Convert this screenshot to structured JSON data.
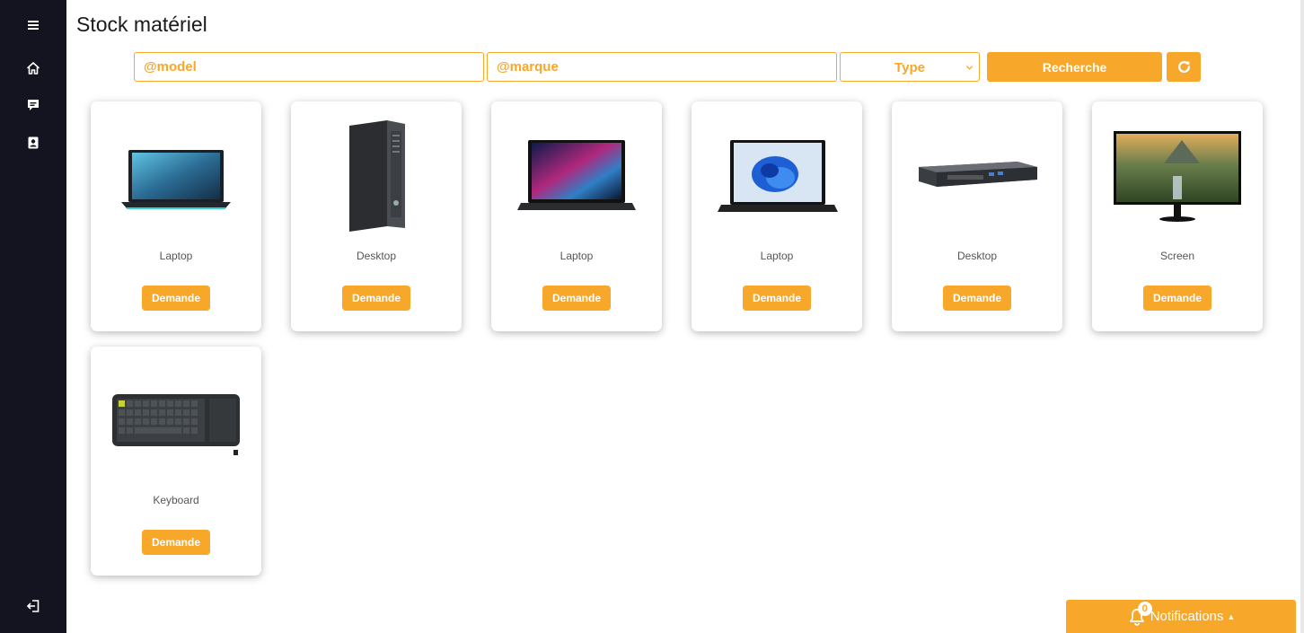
{
  "sidebar": {
    "items": [
      {
        "icon": "menu-icon"
      },
      {
        "icon": "home-icon"
      },
      {
        "icon": "chat-icon"
      },
      {
        "icon": "contact-card-icon"
      }
    ],
    "logout_icon": "logout-icon"
  },
  "header": {
    "title": "Stock matériel"
  },
  "search": {
    "model_placeholder": "@model",
    "marque_placeholder": "@marque",
    "type_label": "Type",
    "search_button": "Recherche",
    "refresh_icon": "refresh-icon"
  },
  "cards": [
    {
      "type": "Laptop",
      "button": "Demande",
      "image": "laptop-gaming"
    },
    {
      "type": "Desktop",
      "button": "Demande",
      "image": "desktop-tower"
    },
    {
      "type": "Laptop",
      "button": "Demande",
      "image": "laptop-dell"
    },
    {
      "type": "Laptop",
      "button": "Demande",
      "image": "laptop-windows"
    },
    {
      "type": "Desktop",
      "button": "Demande",
      "image": "desktop-mini"
    },
    {
      "type": "Screen",
      "button": "Demande",
      "image": "monitor"
    },
    {
      "type": "Keyboard",
      "button": "Demande",
      "image": "keyboard"
    }
  ],
  "notifications": {
    "label": "Notifications",
    "count": "0"
  },
  "colors": {
    "accent": "#f7a72a",
    "sidebar": "#13141f"
  }
}
